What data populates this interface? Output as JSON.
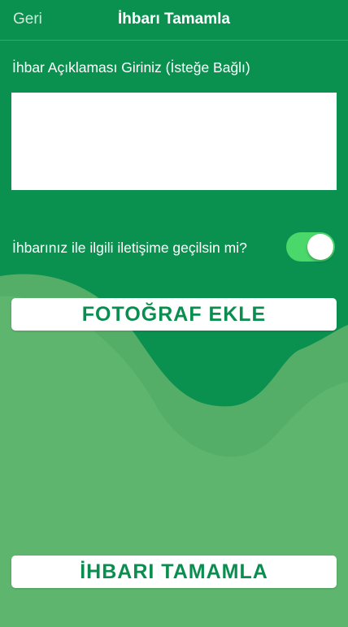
{
  "nav": {
    "back_label": "Geri",
    "title": "İhbarı Tamamla"
  },
  "form": {
    "description_label": "İhbar Açıklaması Giriniz (İsteğe Bağlı)",
    "description_value": "",
    "contact_label": "İhbarınız ile ilgili iletişime geçilsin mi?",
    "contact_toggle_on": true
  },
  "buttons": {
    "add_photo": "FOTOĞRAF EKLE",
    "complete": "İHBARI TAMAMLA"
  },
  "colors": {
    "primary_green": "#0a9150",
    "light_green": "#5db56e",
    "toggle_on": "#4bd86a",
    "button_text": "#0a8e4f"
  }
}
